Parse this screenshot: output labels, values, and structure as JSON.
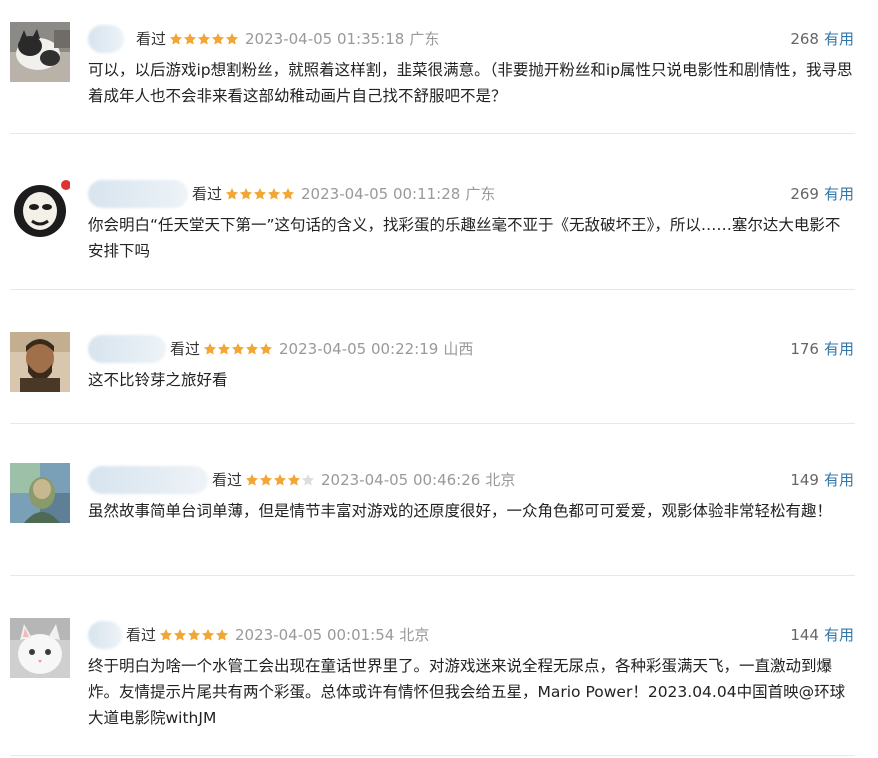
{
  "colors": {
    "star_on": "#f3a634",
    "star_off": "#dddddd",
    "link": "#3377aa",
    "meta": "#999999"
  },
  "reviews": [
    {
      "avatar_icon": "cat-avatar-icon",
      "status": "看过",
      "rating": 5,
      "time": "2023-04-05 01:35:18",
      "location": "广东",
      "useful_count": "268",
      "useful_label": "有用",
      "content": "可以，以后游戏ip想割粉丝，就照着这样割，韭菜很满意。（非要抛开粉丝和ip属性只说电影性和剧情性，我寻思着成年人也不会非来看这部幼稚动画片自己找不舒服吧不是？"
    },
    {
      "avatar_icon": "panda-meme-avatar-icon",
      "status": "看过",
      "rating": 5,
      "time": "2023-04-05 00:11:28",
      "location": "广东",
      "useful_count": "269",
      "useful_label": "有用",
      "content": "你会明白“任天堂天下第一”这句话的含义，找彩蛋的乐趣丝毫不亚于《无敌破坏王》，所以……塞尔达大电影不安排下吗"
    },
    {
      "avatar_icon": "portrait-avatar-icon",
      "status": "看过",
      "rating": 5,
      "time": "2023-04-05 00:22:19",
      "location": "山西",
      "useful_count": "176",
      "useful_label": "有用",
      "content": "这不比铃芽之旅好看"
    },
    {
      "avatar_icon": "painting-avatar-icon",
      "status": "看过",
      "rating": 4,
      "time": "2023-04-05 00:46:26",
      "location": "北京",
      "useful_count": "149",
      "useful_label": "有用",
      "content": "虽然故事简单台词单薄，但是情节丰富对游戏的还原度很好，一众角色都可可爱爱，观影体验非常轻松有趣！"
    },
    {
      "avatar_icon": "kitten-avatar-icon",
      "status": "看过",
      "rating": 5,
      "time": "2023-04-05 00:01:54",
      "location": "北京",
      "useful_count": "144",
      "useful_label": "有用",
      "content": "终于明白为啥一个水管工会出现在童话世界里了。对游戏迷来说全程无尿点，各种彩蛋满天飞，一直激动到爆炸。友情提示片尾共有两个彩蛋。总体或许有情怀但我会给五星，Mario Power！2023.04.04中国首映@环球大道电影院withJM"
    }
  ]
}
